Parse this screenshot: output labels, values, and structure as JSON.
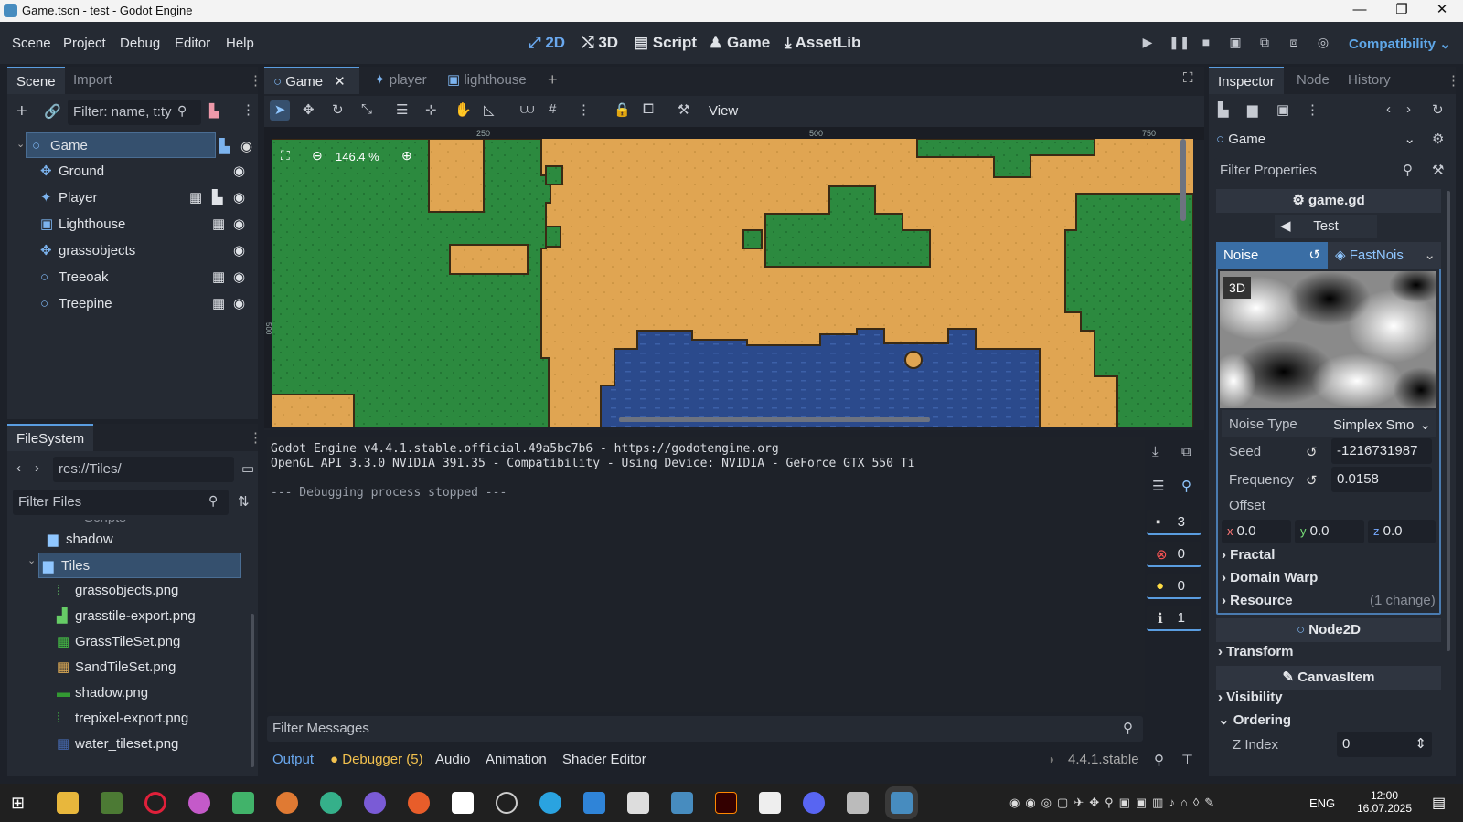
{
  "window": {
    "title": "Game.tscn - test - Godot Engine",
    "min": "—",
    "max": "❐",
    "close": "✕"
  },
  "menu": [
    "Scene",
    "Project",
    "Debug",
    "Editor",
    "Help"
  ],
  "workspaces": [
    {
      "label": "2D",
      "icon": "2d-icon",
      "active": true
    },
    {
      "label": "3D",
      "icon": "3d-icon",
      "active": false
    },
    {
      "label": "Script",
      "icon": "script-icon",
      "active": false
    },
    {
      "label": "Game",
      "icon": "game-icon",
      "active": false
    },
    {
      "label": "AssetLib",
      "icon": "assetlib-icon",
      "active": false
    }
  ],
  "renderer": "Compatibility",
  "scene_dock": {
    "tabs": [
      "Scene",
      "Import"
    ],
    "filter_placeholder": "Filter: name, t:ty",
    "nodes": [
      {
        "name": "Game",
        "type": "node2d"
      },
      {
        "name": "Ground",
        "type": "tilemap"
      },
      {
        "name": "Player",
        "type": "characterbody"
      },
      {
        "name": "Lighthouse",
        "type": "static"
      },
      {
        "name": "grassobjects",
        "type": "tilemap"
      },
      {
        "name": "Treeoak",
        "type": "node2d"
      },
      {
        "name": "Treepine",
        "type": "node2d"
      }
    ]
  },
  "filesystem": {
    "tab": "FileSystem",
    "path": "res://Tiles/",
    "filter_placeholder": "Filter Files",
    "partial_item": "Scripts",
    "folders": [
      "shadow",
      "Tiles"
    ],
    "files": [
      "grassobjects.png",
      "grasstile-export.png",
      "GrassTileSet.png",
      "SandTileSet.png",
      "shadow.png",
      "trepixel-export.png",
      "water_tileset.png"
    ]
  },
  "editor_tabs": [
    "Game",
    "player",
    "lighthouse"
  ],
  "toolbar": {
    "view_label": "View"
  },
  "viewport": {
    "zoom": "146.4 %",
    "ruler_x": [
      "250",
      "500",
      "750"
    ],
    "ruler_y": [
      "500"
    ]
  },
  "console": {
    "lines": [
      "Godot Engine v4.4.1.stable.official.49a5bc7b6 - https://godotengine.org",
      "OpenGL API 3.3.0 NVIDIA 391.35 - Compatibility - Using Device: NVIDIA - GeForce GTX 550 Ti",
      "",
      "--- Debugging process stopped ---"
    ],
    "counts": {
      "messages": "3",
      "errors": "0",
      "warnings": "0",
      "info": "1"
    },
    "filter_placeholder": "Filter Messages"
  },
  "bottom_tabs": [
    "Output",
    "Debugger (5)",
    "Audio",
    "Animation",
    "Shader Editor"
  ],
  "version": "4.4.1.stable",
  "inspector": {
    "tabs": [
      "Inspector",
      "Node",
      "History"
    ],
    "object": "Game",
    "filter_placeholder": "Filter Properties",
    "script_header": "game.gd",
    "test_button": "Test",
    "noise_label": "Noise",
    "noise_value": "FastNois",
    "preview_label": "3D",
    "noise_type_label": "Noise Type",
    "noise_type_value": "Simplex Smo",
    "seed_label": "Seed",
    "seed_value": "-1216731987",
    "frequency_label": "Frequency",
    "frequency_value": "0.0158",
    "offset_label": "Offset",
    "offset": {
      "x_label": "x",
      "x": "0.0",
      "y_label": "y",
      "y": "0.0",
      "z_label": "z",
      "z": "0.0"
    },
    "fractal": "Fractal",
    "domain_warp": "Domain Warp",
    "resource": "Resource",
    "resource_changes": "(1 change)",
    "node2d": "Node2D",
    "transform": "Transform",
    "canvasitem": "CanvasItem",
    "visibility": "Visibility",
    "ordering": "Ordering",
    "zindex_label": "Z Index",
    "zindex_value": "0"
  },
  "taskbar": {
    "lang": "ENG",
    "time": "12:00",
    "date": "16.07.2025"
  },
  "colors": {
    "accent": "#5a9de0",
    "sand": "#e0a552",
    "grass": "#2c8a3f",
    "water": "#2b4a8c"
  }
}
